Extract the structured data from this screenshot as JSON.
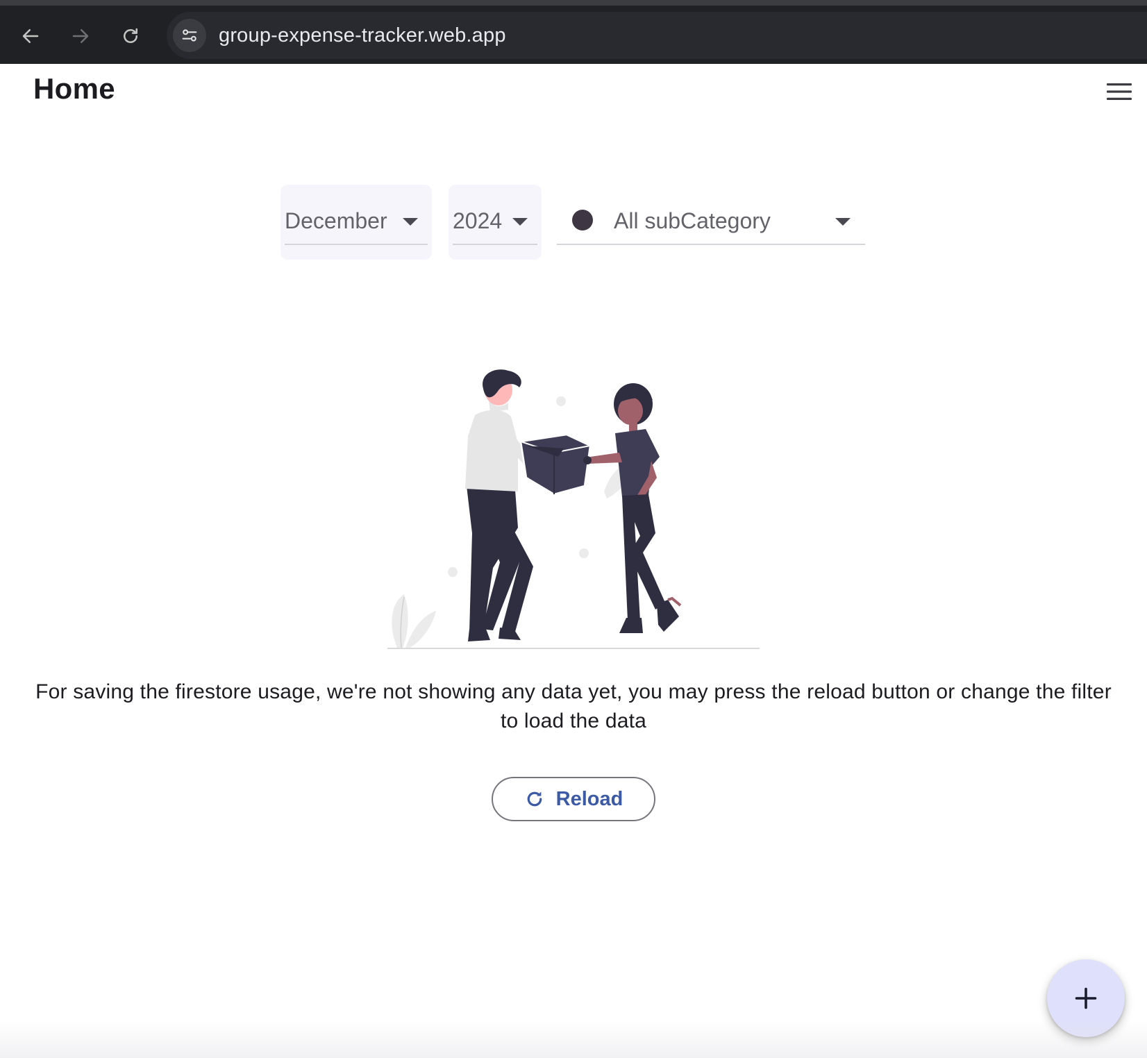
{
  "browser": {
    "url": "group-expense-tracker.web.app",
    "back_icon": "arrow-left-icon",
    "forward_icon": "arrow-right-icon",
    "reload_icon": "refresh-icon",
    "site_info_icon": "tune-icon"
  },
  "app_bar": {
    "title": "Home",
    "menu_icon": "hamburger-menu-icon"
  },
  "filters": {
    "month": {
      "value": "December"
    },
    "year": {
      "value": "2024"
    },
    "subcategory": {
      "value": "All subCategory",
      "dot_color": "#3e3642"
    }
  },
  "empty_state": {
    "illustration": "people-handing-box-illustration",
    "message": "For saving the firestore usage, we're not showing any data yet, you may press the reload button or change the filter to load the data"
  },
  "reload_button": {
    "label": "Reload",
    "icon": "refresh-icon",
    "color": "#3c5aa6"
  },
  "fab": {
    "icon": "plus-icon",
    "color": "#dfe0fb"
  }
}
